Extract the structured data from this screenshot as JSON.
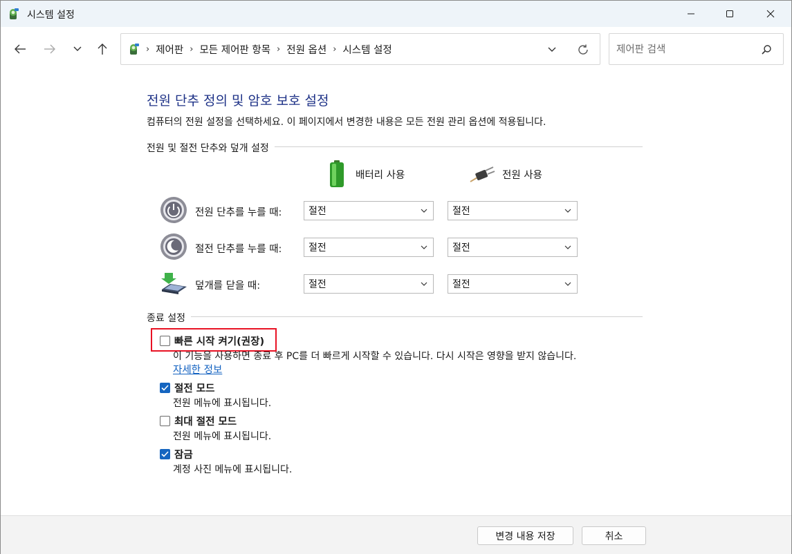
{
  "window": {
    "title": "시스템 설정"
  },
  "address": {
    "crumbs": [
      "제어판",
      "모든 제어판 항목",
      "전원 옵션",
      "시스템 설정"
    ]
  },
  "search": {
    "placeholder": "제어판 검색",
    "value": ""
  },
  "main": {
    "heading": "전원 단추 정의 및 암호 보호 설정",
    "description": "컴퓨터의 전원 설정을 선택하세요. 이 페이지에서 변경한 내용은 모든 전원 관리 옵션에 적용됩니다.",
    "group1_label": "전원 및 절전 단추와 덮개 설정",
    "col_battery": "배터리 사용",
    "col_plugged": "전원 사용",
    "rows": [
      {
        "label": "전원 단추를 누를 때:",
        "battery": "절전",
        "plugged": "절전",
        "icon": "power-button-icon"
      },
      {
        "label": "절전 단추를 누를 때:",
        "battery": "절전",
        "plugged": "절전",
        "icon": "sleep-button-icon"
      },
      {
        "label": "덮개를 닫을 때:",
        "battery": "절전",
        "plugged": "절전",
        "icon": "laptop-lid-icon"
      }
    ],
    "group2_label": "종료 설정",
    "shutdown": [
      {
        "label": "빠른 시작 켜기(권장)",
        "checked": false,
        "desc": "이 기능을 사용하면 종료 후 PC를 더 빠르게 시작할 수 있습니다. 다시 시작은 영향을 받지 않습니다.",
        "link": "자세한 정보"
      },
      {
        "label": "절전 모드",
        "checked": true,
        "desc": "전원 메뉴에 표시됩니다."
      },
      {
        "label": "최대 절전 모드",
        "checked": false,
        "desc": "전원 메뉴에 표시됩니다."
      },
      {
        "label": "잠금",
        "checked": true,
        "desc": "계정 사진 메뉴에 표시됩니다."
      }
    ]
  },
  "footer": {
    "save_label": "변경 내용 저장",
    "cancel_label": "취소"
  },
  "colors": {
    "heading": "#1e3287",
    "link": "#1060c0",
    "checkbox_checked": "#1565c0",
    "highlight": "#e81123"
  }
}
